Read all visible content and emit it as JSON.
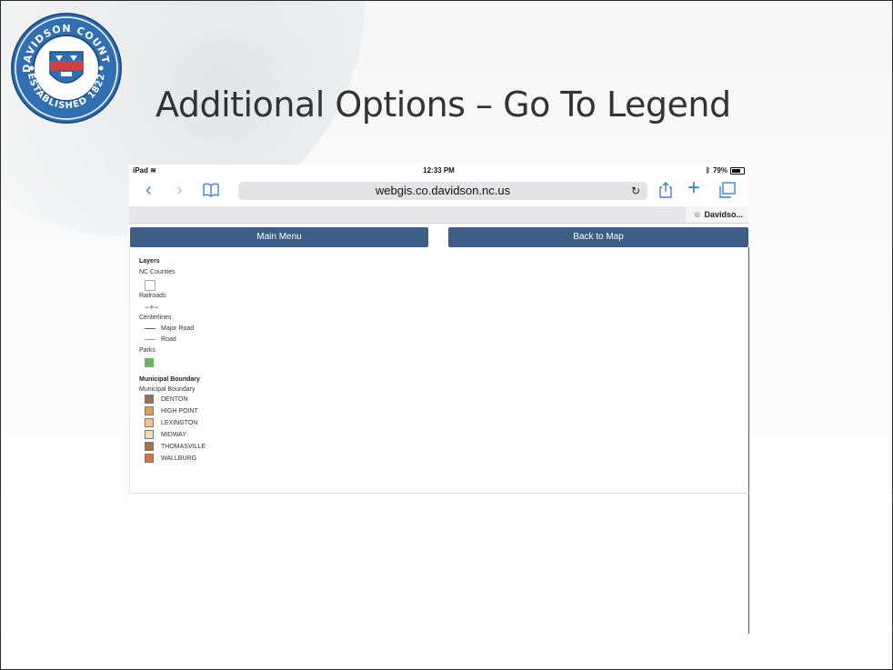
{
  "slide": {
    "title": "Additional Options – Go To Legend",
    "seal": {
      "top_text": "DAVIDSON COUNTY",
      "bottom_text": "ESTABLISHED 1822"
    }
  },
  "status_bar": {
    "device": "iPad",
    "time": "12:33 PM",
    "battery": "79%"
  },
  "browser": {
    "url": "webgis.co.davidson.nc.us",
    "tab_label": "Davidso..."
  },
  "nav": {
    "main_menu": "Main Menu",
    "back_to_map": "Back to Map"
  },
  "legend": {
    "layers_heading": "Layers",
    "nc_counties": "NC Counties",
    "railroads": "Railroads",
    "centerlines": "Centerlines",
    "major_road": "Major Road",
    "road": "Road",
    "parks": "Parks",
    "municipal_heading": "Municipal Boundary",
    "municipal_sub": "Municipal Boundary",
    "municipalities": [
      {
        "label": "DENTON",
        "color": "#a0695a"
      },
      {
        "label": "HIGH POINT",
        "color": "#e0a24a"
      },
      {
        "label": "LEXINGTON",
        "color": "#f4c48a"
      },
      {
        "label": "MIDWAY",
        "color": "#f3dcb8"
      },
      {
        "label": "THOMASVILLE",
        "color": "#a8733a"
      },
      {
        "label": "WALLBURG",
        "color": "#d8743e"
      }
    ],
    "colors": {
      "major_road": "#d03030",
      "road": "#9a9a9a",
      "parks": "#6cb36a"
    }
  },
  "colors": {
    "nav_button": "#3d5d86",
    "safari_accent": "#3b7fe0"
  }
}
